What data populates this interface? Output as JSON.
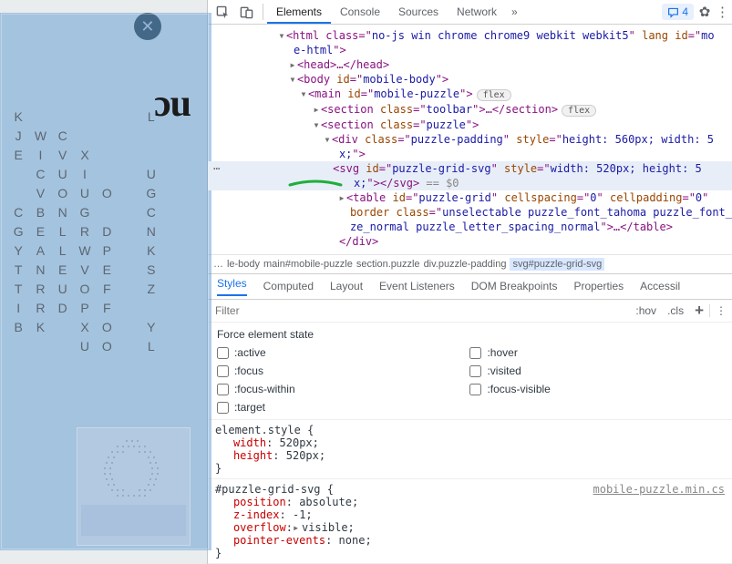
{
  "page": {
    "big_text": "ɔu",
    "close_glyph": "✕",
    "grid_rows": [
      [
        "K",
        "",
        "",
        "",
        "",
        "",
        "L"
      ],
      [
        "J",
        "W",
        "C",
        "",
        "",
        "",
        ""
      ],
      [
        "E",
        "I",
        "V",
        "X",
        "",
        "",
        ""
      ],
      [
        "",
        "C",
        "U",
        "I",
        "",
        "",
        "U"
      ],
      [
        "",
        "V",
        "O",
        "U",
        "O",
        "",
        "G"
      ],
      [
        "C",
        "B",
        "N",
        "G",
        "",
        "",
        "C"
      ],
      [
        "G",
        "E",
        "L",
        "R",
        "D",
        "",
        "N"
      ],
      [
        "Y",
        "A",
        "L",
        "W",
        "P",
        "",
        "K"
      ],
      [
        "T",
        "N",
        "E",
        "V",
        "E",
        "",
        "S"
      ],
      [
        "T",
        "R",
        "U",
        "O",
        "F",
        "",
        "Z"
      ],
      [
        "I",
        "R",
        "D",
        "P",
        "F",
        "",
        ""
      ],
      [
        "B",
        "K",
        "",
        "X",
        "O",
        "",
        "Y"
      ],
      [
        "",
        "",
        "",
        "U",
        "O",
        "",
        "L"
      ]
    ]
  },
  "devtools": {
    "tabs": [
      "Elements",
      "Console",
      "Sources",
      "Network"
    ],
    "active_tab": "Elements",
    "more_glyph": "»",
    "msg_count": "4",
    "dom": {
      "l1a": "<html class=\"",
      "l1b": "no-js win chrome chrome9 webkit webkit5",
      "l1c": "\" lang id=\"",
      "l1d": "mo",
      "l2a": "e-html",
      "l2b": "\">",
      "l3": "<head>…</head>",
      "l4a": "<body id=\"",
      "l4b": "mobile-body",
      "l4c": "\">",
      "l5a": "<main id=\"",
      "l5b": "mobile-puzzle",
      "l5c": "\">",
      "l5badge": "flex",
      "l6a": "<section class=\"",
      "l6b": "toolbar",
      "l6c": "\">…</section>",
      "l6badge": "flex",
      "l7a": "<section class=\"",
      "l7b": "puzzle",
      "l7c": "\">",
      "l8a": "<div class=\"",
      "l8b": "puzzle-padding",
      "l8c": "\" style=\"",
      "l8d": "height: 560px; width: 5",
      "l8e": "x;",
      "l8f": "\">",
      "l9a": "<svg id=\"",
      "l9b": "puzzle-grid-svg",
      "l9c": "\" style=\"",
      "l9d": "width: 520px; height: 5",
      "l9e": "x;",
      "l9f": "\"></svg>",
      "l9g": " == $0",
      "l10a": "<table id=\"",
      "l10b": "puzzle-grid",
      "l10c": "\" cellspacing=\"",
      "l10d": "0",
      "l10e": "\" cellpadding=\"",
      "l10f": "0",
      "l10g": "\"",
      "l11a": "border class=\"",
      "l11b": "unselectable puzzle_font_tahoma puzzle_font_",
      "l12a": "ze_normal puzzle_letter_spacing_normal",
      "l12b": "\">…</table>",
      "l13": "</div>",
      "dots": "⋯"
    },
    "breadcrumb": {
      "dots": "…",
      "items": [
        "le-body",
        "main#mobile-puzzle",
        "section.puzzle",
        "div.puzzle-padding",
        "svg#puzzle-grid-svg"
      ]
    },
    "styles_tabs": [
      "Styles",
      "Computed",
      "Layout",
      "Event Listeners",
      "DOM Breakpoints",
      "Properties",
      "Accessil"
    ],
    "active_styles_tab": "Styles",
    "filter_placeholder": "Filter",
    "hov": ":hov",
    "cls": ".cls",
    "force": {
      "title": "Force element state",
      "left": [
        ":active",
        ":focus",
        ":focus-within",
        ":target"
      ],
      "right": [
        ":hover",
        ":visited",
        ":focus-visible"
      ]
    },
    "rule1": {
      "sel": "element.style",
      "props": [
        [
          "width",
          "520px"
        ],
        [
          "height",
          "520px"
        ]
      ]
    },
    "rule2": {
      "sel": "#puzzle-grid-svg",
      "src": "mobile-puzzle.min.cs",
      "props": [
        [
          "position",
          "absolute"
        ],
        [
          "z-index",
          "-1"
        ],
        [
          "overflow",
          "visible",
          true
        ],
        [
          "pointer-events",
          "none"
        ]
      ]
    }
  }
}
